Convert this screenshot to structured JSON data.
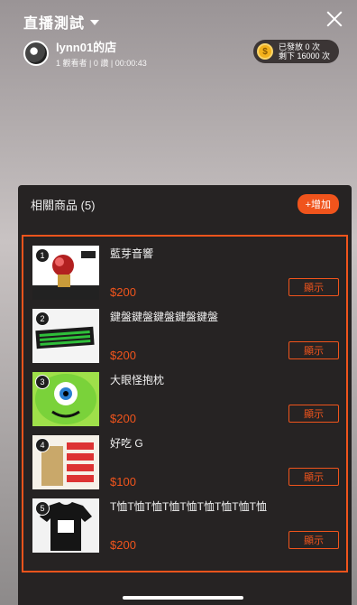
{
  "header": {
    "title": "直播測試",
    "host_name": "lynn01的店",
    "host_meta": "1 觀看者 | 0 讚 | 00:00:43",
    "coins": {
      "line1": "已發放 0 次",
      "line2": "剩下 16000 次"
    }
  },
  "panel": {
    "title": "相關商品 (5)",
    "add_label": "+增加"
  },
  "products": [
    {
      "index": "1",
      "name": "藍芽音響",
      "price": "$200",
      "button": "顯示"
    },
    {
      "index": "2",
      "name": "鍵盤鍵盤鍵盤鍵盤鍵盤",
      "price": "$200",
      "button": "顯示"
    },
    {
      "index": "3",
      "name": "大眼怪抱枕",
      "price": "$200",
      "button": "顯示"
    },
    {
      "index": "4",
      "name": "好吃 G",
      "price": "$100",
      "button": "顯示"
    },
    {
      "index": "5",
      "name": "T恤T恤T恤T恤T恤T恤T恤T恤T恤",
      "price": "$200",
      "button": "顯示"
    }
  ],
  "colors": {
    "accent": "#f0541c",
    "panel_bg": "#262323"
  }
}
